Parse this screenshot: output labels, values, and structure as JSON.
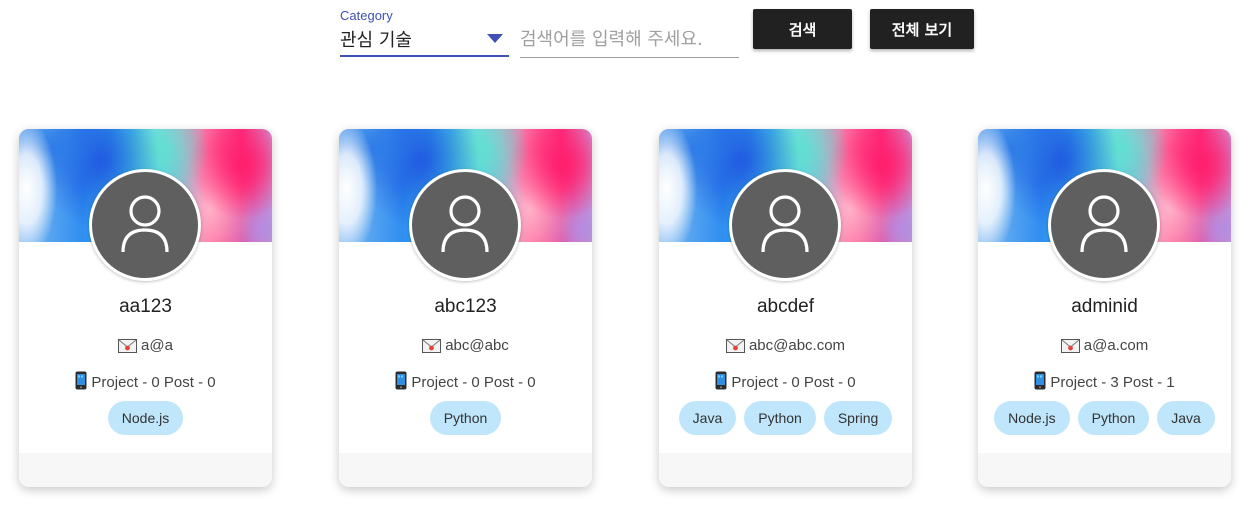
{
  "search": {
    "category_label": "Category",
    "category_value": "관심 기술",
    "placeholder": "검색어를 입력해 주세요.",
    "search_button": "검색",
    "view_all_button": "전체 보기",
    "accent_color": "#3f51b5"
  },
  "cards": [
    {
      "name": "aa123",
      "email": "a@a",
      "stats": "Project - 0 Post - 0",
      "tags": [
        "Node.js"
      ]
    },
    {
      "name": "abc123",
      "email": "abc@abc",
      "stats": "Project - 0 Post - 0",
      "tags": [
        "Python"
      ]
    },
    {
      "name": "abcdef",
      "email": "abc@abc.com",
      "stats": "Project - 0 Post - 0",
      "tags": [
        "Java",
        "Python",
        "Spring"
      ]
    },
    {
      "name": "adminid",
      "email": "a@a.com",
      "stats": "Project - 3 Post - 1",
      "tags": [
        "Node.js",
        "Python",
        "Java"
      ]
    }
  ],
  "icons": {
    "avatar": "user-avatar-icon",
    "email": "envelope-icon",
    "stats": "mobile-phone-icon",
    "dropdown": "caret-down-icon"
  },
  "colors": {
    "button_bg": "#212121",
    "tag_bg": "#bfe6fa",
    "avatar_bg": "#5f5f5f"
  }
}
